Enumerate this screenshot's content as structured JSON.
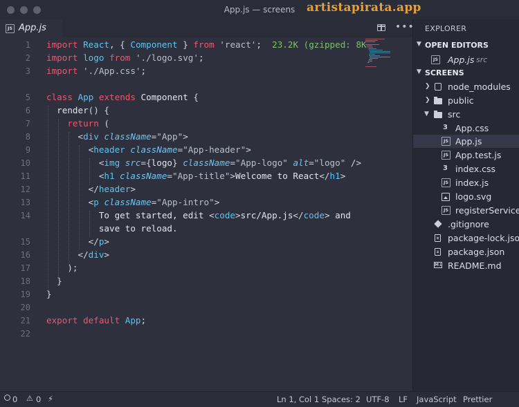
{
  "window": {
    "title": "App.js — screens",
    "watermark": "artistapirata.app"
  },
  "tabs": [
    {
      "label": "App.js",
      "icon": "js-icon"
    }
  ],
  "editor": {
    "line_numbers": [
      "1",
      "2",
      "3",
      "",
      "5",
      "6",
      "7",
      "8",
      "9",
      "10",
      "11",
      "12",
      "13",
      "14",
      "",
      "15",
      "16",
      "17",
      "18",
      "19",
      "20",
      "21",
      "22"
    ],
    "import_size_hint": "23.2K (gzipped: 8K"
  },
  "explorer": {
    "header": "EXPLORER",
    "open_editors_label": "OPEN EDITORS",
    "open_editor": {
      "name": "App.js",
      "path": "src"
    },
    "project_label": "SCREENS",
    "items": [
      {
        "name": "node_modules",
        "kind": "folder-node",
        "expanded": false
      },
      {
        "name": "public",
        "kind": "folder",
        "expanded": false
      },
      {
        "name": "src",
        "kind": "folder",
        "expanded": true
      },
      {
        "name": "App.css",
        "kind": "css"
      },
      {
        "name": "App.js",
        "kind": "js",
        "selected": true
      },
      {
        "name": "App.test.js",
        "kind": "js"
      },
      {
        "name": "index.css",
        "kind": "css"
      },
      {
        "name": "index.js",
        "kind": "js"
      },
      {
        "name": "logo.svg",
        "kind": "svg"
      },
      {
        "name": "registerService...",
        "kind": "js"
      },
      {
        "name": ".gitignore",
        "kind": "git"
      },
      {
        "name": "package-lock.json",
        "kind": "json"
      },
      {
        "name": "package.json",
        "kind": "json"
      },
      {
        "name": "README.md",
        "kind": "md"
      }
    ]
  },
  "status": {
    "errors": "0",
    "warnings": "0",
    "position": "Ln 1, Col 1",
    "spaces": "Spaces: 2",
    "encoding": "UTF-8",
    "eol": "LF",
    "language": "JavaScript",
    "formatter": "Prettier"
  },
  "colors": {
    "keyword": "#f0576e",
    "identifier": "#5cc6ef",
    "accent_green": "#7ec16b",
    "watermark": "#e5a03a"
  }
}
